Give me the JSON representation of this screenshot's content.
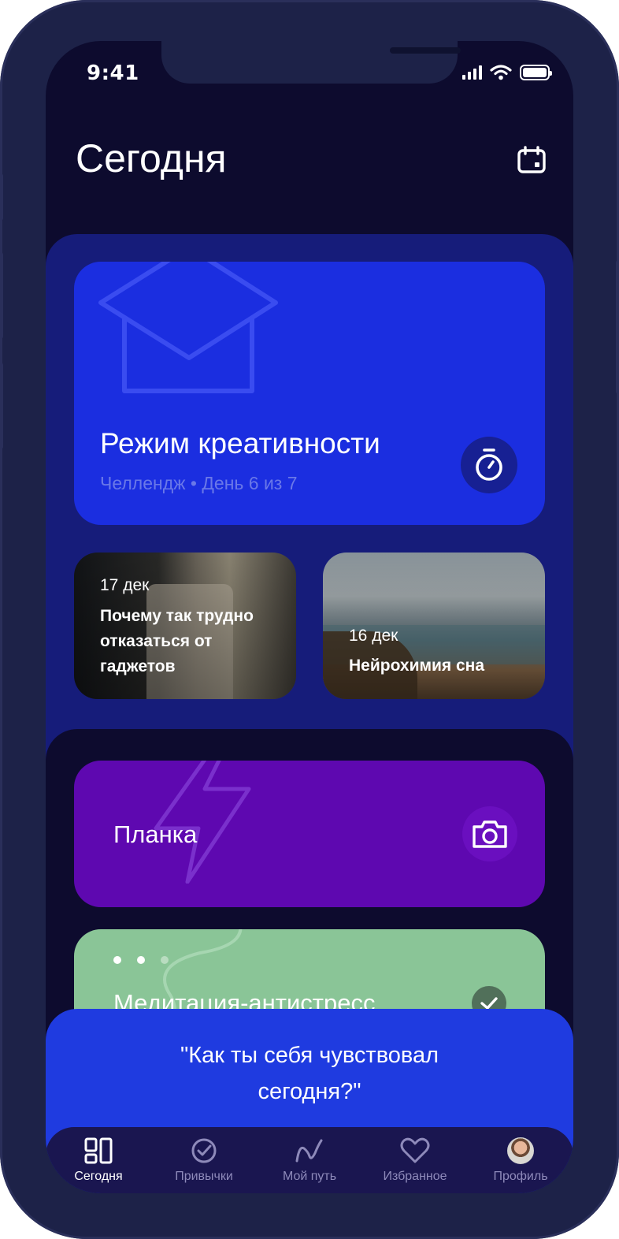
{
  "status": {
    "time": "9:41"
  },
  "header": {
    "title": "Сегодня",
    "calendar_icon": "calendar-icon"
  },
  "challenge": {
    "title": "Режим креативности",
    "subtitle": "Челлендж • День 6 из 7",
    "icon": "timer-icon",
    "color": "#1b2ee0"
  },
  "articles": [
    {
      "date": "17 дек",
      "title_lines": [
        "Почему так трудно",
        "отказаться от",
        "гаджетов"
      ]
    },
    {
      "date": "16 дек",
      "title": "Нейрохимия сна"
    }
  ],
  "habits": [
    {
      "title": "Планка",
      "icon": "camera-icon",
      "color": "#5e08b0"
    },
    {
      "title": "Медитация-антистресс",
      "icon": "check-icon",
      "color": "#8ac597",
      "progress_dots": 3,
      "progress_done": 2
    }
  ],
  "prompt": {
    "text_line1": "\"Как ты себя чувствовал",
    "text_line2": "сегодня?\""
  },
  "tabs": [
    {
      "label": "Сегодня",
      "icon": "today-icon",
      "active": true
    },
    {
      "label": "Привычки",
      "icon": "check-circle-icon",
      "active": false
    },
    {
      "label": "Мой путь",
      "icon": "path-icon",
      "active": false
    },
    {
      "label": "Избранное",
      "icon": "heart-icon",
      "active": false
    },
    {
      "label": "Профиль",
      "icon": "avatar",
      "active": false
    }
  ]
}
